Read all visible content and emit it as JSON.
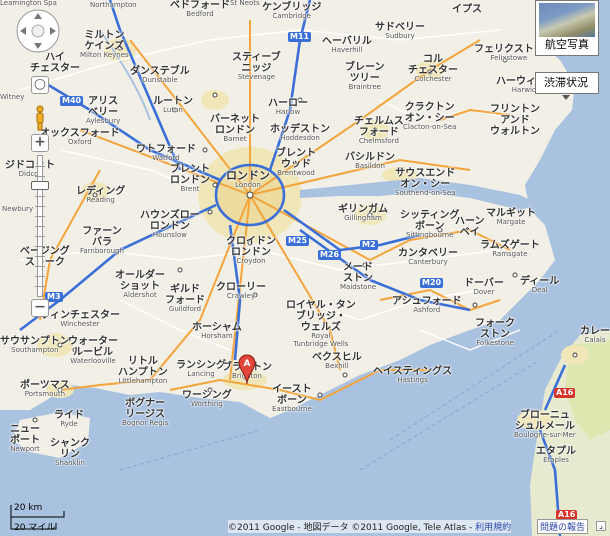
{
  "controls": {
    "zoom_in": "+",
    "zoom_out": "−",
    "satellite_label": "航空写真",
    "traffic_label": "渋滞状況",
    "scale_km": "20 km",
    "scale_mi": "20 マイル",
    "report_label": "問題の報告",
    "copyright_text": "©2011 Google - 地図データ ©2011 Google, Tele Atlas - ",
    "terms_link": "利用規約"
  },
  "marker": {
    "letter": "A"
  },
  "colors": {
    "sea": "#a9c2e0",
    "land": "#f2efe6",
    "urban": "#f0e6b8",
    "motorway": "#3a6fd8",
    "a_road": "#f3a43b",
    "local_road": "#ffffff",
    "marker": "#e2463a"
  },
  "places": [
    {
      "jp": "レミントン",
      "en": "Leamington Spa"
    },
    {
      "jp": "ノーサンプトン",
      "en": "Northampton"
    },
    {
      "jp": "ベドフォード",
      "en": "Bedford"
    },
    {
      "jp": "セント・ネオッツ",
      "en": "St Neots"
    },
    {
      "jp": "ケンブリッジ",
      "en": "Cambridge"
    },
    {
      "jp": "イプス",
      "en": "Ipswich"
    },
    {
      "jp": "サドベリー",
      "en": "Sudbury"
    },
    {
      "jp": "ヘーバリル",
      "en": "Haverhill"
    },
    {
      "jp": "ミルトン ケインズ",
      "en": "Milton Keynes"
    },
    {
      "jp": "ダンステブル",
      "en": "Dunstable"
    },
    {
      "jp": "スティーブニッジ",
      "en": "Stevenage"
    },
    {
      "jp": "ブレーン ツリー",
      "en": "Braintree"
    },
    {
      "jp": "コル チェスター",
      "en": "Colchester"
    },
    {
      "jp": "ハーウィッチ",
      "en": "Harwich"
    },
    {
      "jp": "フェリクストウ",
      "en": "Felixstowe"
    },
    {
      "jp": "ハイ ウィコム",
      "en": "High Wycombe"
    },
    {
      "jp": "アリス ベリー",
      "en": "Aylesbury"
    },
    {
      "jp": "ルートン",
      "en": "Luton"
    },
    {
      "jp": "ハーロー",
      "en": "Harlow"
    },
    {
      "jp": "クラクトン オン・シー",
      "en": "Clacton-on-Sea"
    },
    {
      "jp": "フリントン アンド ウォルトン",
      "en": "Frinton and Walton"
    },
    {
      "jp": "オックスフォード",
      "en": "Oxford"
    },
    {
      "jp": "バーネット ロンドン",
      "en": "Barnet"
    },
    {
      "jp": "ホッデストン",
      "en": "Hoddesdon"
    },
    {
      "jp": "チェルムス フォード",
      "en": "Chelmsford"
    },
    {
      "jp": "ワトフォード",
      "en": "Watford"
    },
    {
      "jp": "ブレント ウッド",
      "en": "Brentwood"
    },
    {
      "jp": "ブレント ロンドン",
      "en": "Brent"
    },
    {
      "jp": "ロンドン",
      "en": "London"
    },
    {
      "jp": "バシルドン",
      "en": "Basildon"
    },
    {
      "jp": "アビンドン",
      "en": "Abingdon"
    },
    {
      "jp": "サウスエンド オン・シー",
      "en": "Southend-on-Sea"
    },
    {
      "jp": "レディング",
      "en": "Reading"
    },
    {
      "jp": "ハウンズロー ロンドン",
      "en": "Hounslow"
    },
    {
      "jp": "ギリンガム",
      "en": "Gillingham"
    },
    {
      "jp": "シッティング ボーン",
      "en": "Sittingbourne"
    },
    {
      "jp": "ハーン ベイ",
      "en": "Herne Bay"
    },
    {
      "jp": "マルギット",
      "en": "Margate"
    },
    {
      "jp": "ニューベリー",
      "en": "Newbury"
    },
    {
      "jp": "ファーン バラ",
      "en": "Farnborough"
    },
    {
      "jp": "クロイドン ロンドン",
      "en": "Croydon"
    },
    {
      "jp": "メード ストン",
      "en": "Maidstone"
    },
    {
      "jp": "カンタベリー",
      "en": "Canterbury"
    },
    {
      "jp": "ラムズゲート",
      "en": "Ramsgate"
    },
    {
      "jp": "ベージング ストーク",
      "en": "Basingstoke"
    },
    {
      "jp": "オールダー ショット",
      "en": "Aldershot"
    },
    {
      "jp": "ギルド フォード",
      "en": "Guildford"
    },
    {
      "jp": "クローリー",
      "en": "Crawley"
    },
    {
      "jp": "ドーバー",
      "en": "Dover"
    },
    {
      "jp": "ディール",
      "en": "Deal"
    },
    {
      "jp": "アシュフォード",
      "en": "Ashford"
    },
    {
      "jp": "ウィンチェスター",
      "en": "Winchester"
    },
    {
      "jp": "ロイヤル・タン ブリッジ・ ウェルズ",
      "en": "Royal Tunbridge Wells"
    },
    {
      "jp": "フォーク ストン",
      "en": "Folkestone"
    },
    {
      "jp": "カレー",
      "en": "Calais"
    },
    {
      "jp": "サウサンプトン",
      "en": "Southampton"
    },
    {
      "jp": "ウォーター ルービル",
      "en": "Waterlooville"
    },
    {
      "jp": "ホーシャム",
      "en": "Horsham"
    },
    {
      "jp": "ベクスヒル",
      "en": "Bexhill"
    },
    {
      "jp": "ヘイスティングス",
      "en": "Hastings"
    },
    {
      "jp": "リトル ハンプトン",
      "en": "Littlehampton"
    },
    {
      "jp": "ランシング",
      "en": "Lancing"
    },
    {
      "jp": "ブライトン",
      "en": "Brighton"
    },
    {
      "jp": "ポーツマス",
      "en": "Portsmouth"
    },
    {
      "jp": "ワーシング",
      "en": "Worthing"
    },
    {
      "jp": "イースト ボーン",
      "en": "Eastbourne"
    },
    {
      "jp": "ボグナー リージス",
      "en": "Bognor Regis"
    },
    {
      "jp": "ライド",
      "en": "Ryde"
    },
    {
      "jp": "ニュー ポート",
      "en": "Newport"
    },
    {
      "jp": "シャンク リン",
      "en": "Shanklin"
    },
    {
      "jp": "ブローニュ シュルメール",
      "en": "Boulogne-sur-Mer"
    },
    {
      "jp": "エタプル",
      "en": "Étaples"
    },
    {
      "jp": "ジドコット",
      "en": "Didcot"
    },
    {
      "jp": "ウィットニー",
      "en": "Witney"
    }
  ],
  "roads": [
    "M11",
    "M40",
    "M3",
    "M25",
    "M26",
    "M2",
    "M20",
    "A16",
    "A16"
  ]
}
